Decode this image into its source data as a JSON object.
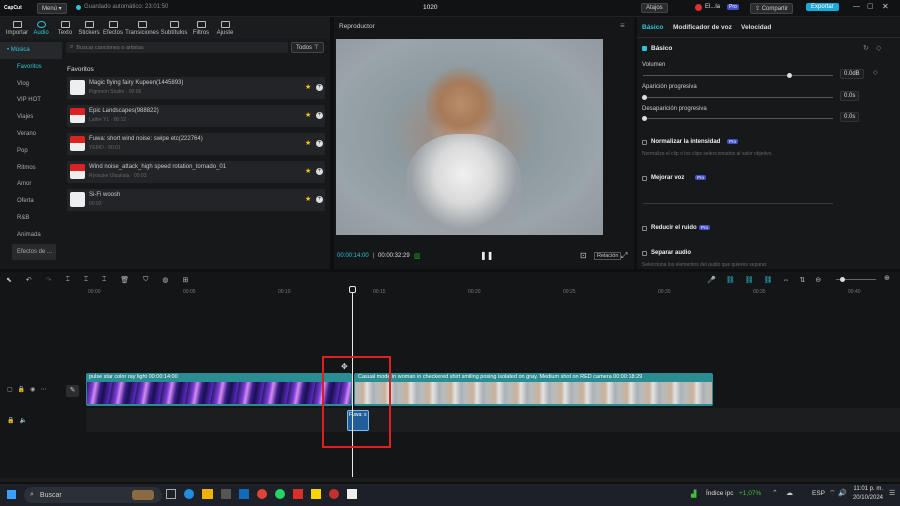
{
  "app": {
    "logo_text": "CapCut",
    "menu_label": "Menú",
    "autosave": "Guardado automático: 23:01:50",
    "title": "1020",
    "shortcuts": "Atajos",
    "user": "El...la",
    "pro": "Pro",
    "share": "Compartir",
    "export": "Exportar"
  },
  "toolbar": {
    "items": [
      {
        "label": "Importar",
        "icon": "import-icon"
      },
      {
        "label": "Audio",
        "icon": "audio-icon",
        "active": true
      },
      {
        "label": "Texto",
        "icon": "text-icon"
      },
      {
        "label": "Stickers",
        "icon": "sticker-icon"
      },
      {
        "label": "Efectos",
        "icon": "effects-icon"
      },
      {
        "label": "Transiciones",
        "icon": "transition-icon"
      },
      {
        "label": "Subtítulos",
        "icon": "subtitles-icon"
      },
      {
        "label": "Filtros",
        "icon": "filter-icon"
      },
      {
        "label": "Ajuste",
        "icon": "adjust-icon"
      }
    ]
  },
  "leftnav": {
    "group": "• Música",
    "items": [
      "Favoritos",
      "Vlog",
      "VIP HOT",
      "Viajes",
      "Verano",
      "Pop",
      "Ritmos",
      "Amor",
      "Oferta",
      "R&B",
      "Animada",
      "Efectos de ..."
    ]
  },
  "media": {
    "search_placeholder": "Buscar canciones o artistas",
    "filter_label": "Todos",
    "section": "Favoritos",
    "items": [
      {
        "title": "Magic flying fairy Kupeen(1445893)",
        "sub": "Pigmoon Studio · 00:06"
      },
      {
        "title": "Epic Landscapes(988822)",
        "sub": "Lattre Y1 · 00:12"
      },
      {
        "title": "Fuwa: short wind noise: swipe etc(222764)",
        "sub": "YEMO · 00:01"
      },
      {
        "title": "Wind noise_attack_high speed rotation_tornado_01",
        "sub": "Ryosuke Utsukata · 00:03"
      },
      {
        "title": "Si-Fi woosh",
        "sub": "00:03"
      }
    ]
  },
  "player": {
    "title": "Reproductor",
    "time_current": "00:00:14:00",
    "time_total": "00:00:32:29",
    "ratio": "Relación"
  },
  "props": {
    "tabs": [
      "Básico",
      "Modificador de voz",
      "Velocidad"
    ],
    "basic": "Básico",
    "volume": {
      "label": "Volumen",
      "value": "0.0dB",
      "level": 0.78
    },
    "fadein": {
      "label": "Aparición progresiva",
      "value": "0.0s"
    },
    "fadeout": {
      "label": "Desaparición progresiva",
      "value": "0.0s"
    },
    "normalize": {
      "label": "Normalizar la intensidad",
      "desc": "Normaliza el clip o los clips seleccionados al valor objetivo."
    },
    "enhance": "Mejorar voz",
    "denoise": "Reducir el ruido",
    "separate": {
      "label": "Separar audio",
      "desc": "Selecciona los elementos del audio que quieres separar."
    }
  },
  "timeline": {
    "ruler": [
      "00:00",
      "00:05",
      "00:10",
      "00:15",
      "00:20",
      "00:25",
      "00:30",
      "00:35",
      "00:40"
    ],
    "clip1": "pulse star color ray light  00:00:14:00",
    "clip2": "Casual mode in woman in checkered shirt smiling posing isolated on gray. Medium shot on RED camera   00:00:18:29",
    "audio_clip": "Fuwa: s"
  },
  "taskbar": {
    "search": "Buscar",
    "stock": "Índice ipc",
    "stock_change": "+1,07%",
    "lang": "ESP",
    "time": "11:01 p. m.",
    "date": "20/10/2024"
  },
  "colors": {
    "accent": "#2ec4d6",
    "export": "#1aa9d8",
    "selection": "#e02020",
    "video_track": "#2a8d92"
  }
}
